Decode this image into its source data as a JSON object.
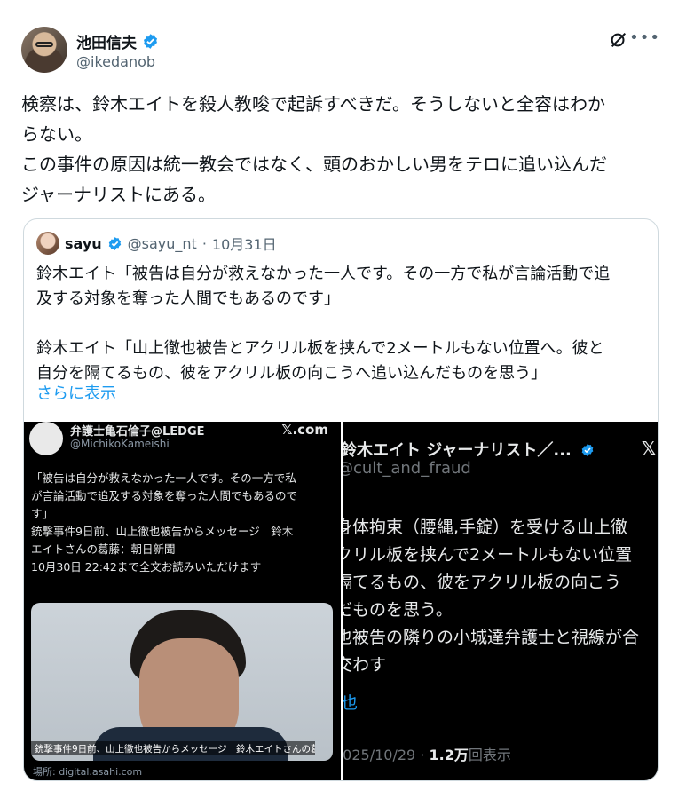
{
  "author": {
    "display_name": "池田信夫",
    "handle": "@ikedanob"
  },
  "icons": [
    "verified-badge-icon",
    "grok-icon",
    "more-icon",
    "x-logo-icon"
  ],
  "tweet": {
    "lines": [
      "検察は、鈴木エイトを殺人教唆で起訴すべきだ。そうしないと全容はわか",
      "らない。",
      "この事件の原因は統一教会ではなく、頭のおかしい男をテロに追い込んだ",
      "ジャーナリストにある。"
    ]
  },
  "quote": {
    "name": "sayu",
    "handle": "@sayu_nt",
    "dot": "·",
    "date": "10月31日",
    "para1": [
      "鈴木エイト「被告は自分が救えなかった一人です。その一方で私が言論活動で追",
      "及する対象を奪った人間でもあるのです」"
    ],
    "para2": [
      "鈴木エイト「山上徹也被告とアクリル板を挟んで2メートルもない位置へ。彼と",
      "自分を隔てるもの、彼をアクリル板の向こうへ追い込んだものを思う」"
    ],
    "show_more": "さらに表示"
  },
  "media_left": {
    "name": "弁護士亀石倫子@LEDGE",
    "handle": "@MichikoKameishi",
    "site": "𝕏.com",
    "lines": [
      "「被告は自分が救えなかった一人です。その一方で私",
      "が言論活動で追及する対象を奪った人間でもあるので",
      "す」",
      "銃撃事件9日前、山上徹也被告からメッセージ　鈴木",
      "エイトさんの葛藤：朝日新聞",
      "10月30日 22:42まで全文お読みいただけます"
    ],
    "caption": "銃撃事件9日前、山上徹也被告からメッセージ　鈴木エイトさんの葛藤…",
    "source": "場所: digital.asahi.com"
  },
  "media_right": {
    "name": "鈴木エイト ジャーナリスト／...",
    "handle": "@cult_and_fraud",
    "lines": [
      "身体拘束（腰縄,手錠）を受ける山上徹",
      "クリル板を挟んで2メートルもない位置",
      "隔てるもの、彼をアクリル板の向こう",
      "だものを思う。",
      "也被告の隣りの小城達弁護士と視線が合",
      "交わす"
    ],
    "link": "也",
    "date": "2025/10/29",
    "dot": "·",
    "views_count": "1.2万",
    "views_label": "回表示"
  }
}
